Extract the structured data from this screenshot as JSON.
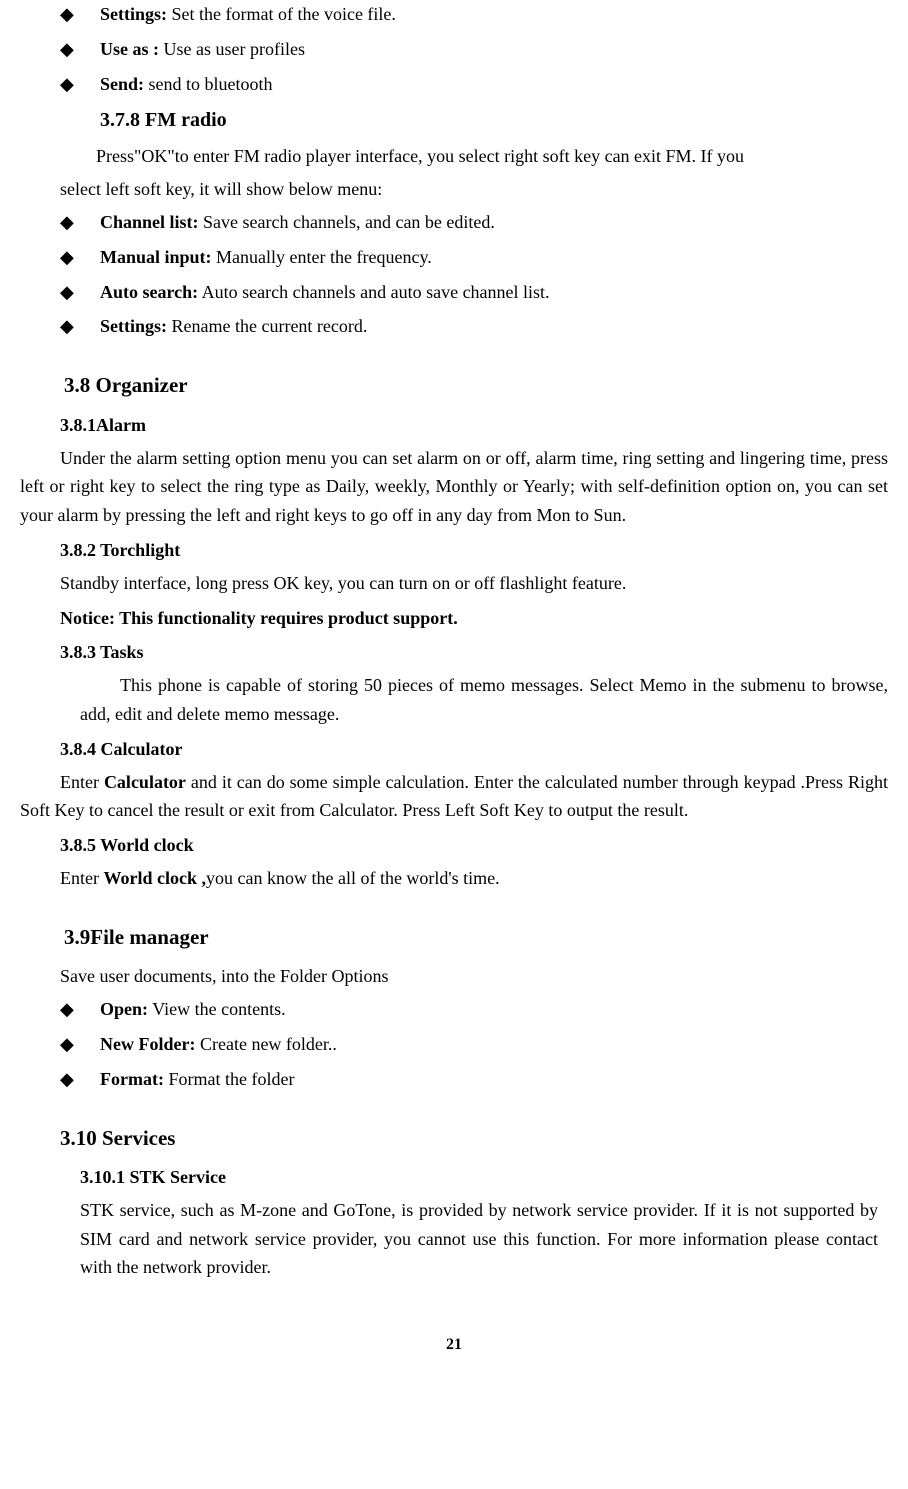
{
  "top_bullets": [
    {
      "label": "Settings:",
      "text": " Set the format of the voice file."
    },
    {
      "label": "Use as :",
      "text": " Use as user profiles"
    },
    {
      "label": "Send:",
      "text": " send to bluetooth"
    }
  ],
  "s378": {
    "heading": "3.7.8 FM radio",
    "para1_a": "Press",
    "para1_b": "\"OK\"",
    "para1_c": "to enter FM radio player interface, you select right soft key can exit FM. If you",
    "para2": "select left soft key, it will show below menu:",
    "bullets": [
      {
        "label": "Channel list:",
        "text": " Save search channels, and can be edited."
      },
      {
        "label": "Manual input:",
        "text": " Manually enter the frequency."
      },
      {
        "label": "Auto search:",
        "text": " Auto search channels and auto save channel list."
      },
      {
        "label": "Settings:",
        "text": " Rename the current record."
      }
    ]
  },
  "s38": {
    "heading": "3.8 Organizer",
    "s381": {
      "heading": "3.8.1Alarm",
      "para": "Under the alarm setting option menu you can set alarm on or off, alarm time, ring setting and lingering time, press left or right key to select the ring type as Daily, weekly, Monthly or Yearly; with self-definition option on, you can set your alarm by pressing the left and right keys to go off in any day from Mon to Sun."
    },
    "s382": {
      "heading": "3.8.2 Torchlight",
      "para": "Standby interface, long press OK key, you can turn on or off flashlight feature.",
      "notice": "Notice: This functionality requires product support."
    },
    "s383": {
      "heading": "3.8.3 Tasks",
      "para": "This phone is capable of storing 50 pieces of memo messages. Select Memo in the submenu to browse, add, edit and delete memo message."
    },
    "s384": {
      "heading": "3.8.4 Calculator",
      "pre": "Enter ",
      "bold": "Calculator",
      "post": " and it can do some simple calculation. Enter the calculated number through keypad .Press Right Soft Key to cancel the result or exit from Calculator. Press Left Soft Key to output the result."
    },
    "s385": {
      "heading": "3.8.5 World clock",
      "pre": "Enter ",
      "bold": "World clock ,",
      "post": "you can know the all of the world's time."
    }
  },
  "s39": {
    "heading": "3.9File manager",
    "para": "Save user documents, into the Folder Options",
    "bullets": [
      {
        "label": "Open:",
        "text": " View the contents."
      },
      {
        "label": "New Folder:",
        "text": " Create new folder.."
      },
      {
        "label": "Format:",
        "text": " Format the folder"
      }
    ]
  },
  "s310": {
    "heading": "3.10 Services",
    "s3101": {
      "heading": "3.10.1 STK Service",
      "para": "STK service, such as M-zone and GoTone, is provided by network service provider. If it is not supported by SIM card and network service provider, you cannot use this function. For more information please contact with the network provider."
    }
  },
  "page_num": "21"
}
